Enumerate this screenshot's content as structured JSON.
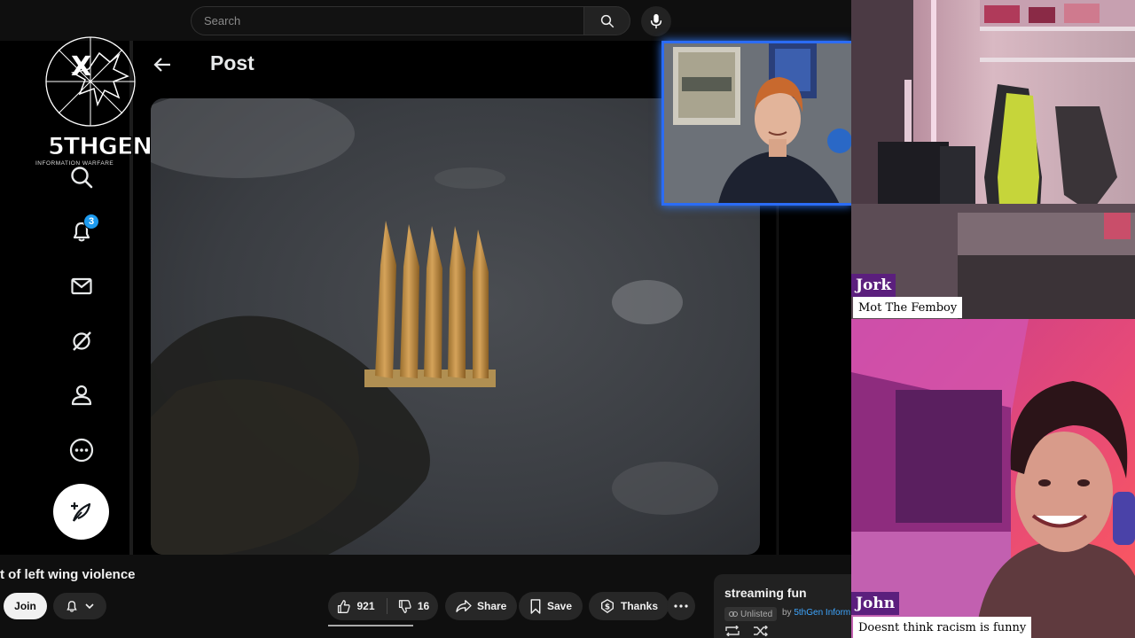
{
  "topbar": {
    "search_placeholder": "Search"
  },
  "logo": {
    "brand_text": "5THGEN",
    "sub_text": "INFORMATION WARFARE"
  },
  "x_sidebar": {
    "notification_count": "3",
    "items": [
      {
        "icon": "search-icon"
      },
      {
        "icon": "bell-icon"
      },
      {
        "icon": "mail-icon"
      },
      {
        "icon": "grok-icon"
      },
      {
        "icon": "profile-icon"
      },
      {
        "icon": "more-icon"
      }
    ],
    "compose_icon": "compose-feather-icon"
  },
  "post": {
    "title": "Post"
  },
  "video": {
    "title": "t of left wing violence",
    "join_label": "Join",
    "like_count": "921",
    "dislike_count": "16",
    "share_label": "Share",
    "save_label": "Save",
    "thanks_label": "Thanks"
  },
  "playlist": {
    "title": "streaming fun",
    "visibility": "Unlisted",
    "by_prefix": "by",
    "channel": "5thGen Inform"
  },
  "webcams": {
    "jork": {
      "name": "Jork",
      "subtitle": "Mot The Femboy"
    },
    "john": {
      "name": "John",
      "subtitle": "Doesnt think racism is funny"
    }
  },
  "colors": {
    "name_tag_bg": "#5b1f7d",
    "x_blue": "#1d9bf0",
    "cam_border": "#2b6cf5"
  }
}
